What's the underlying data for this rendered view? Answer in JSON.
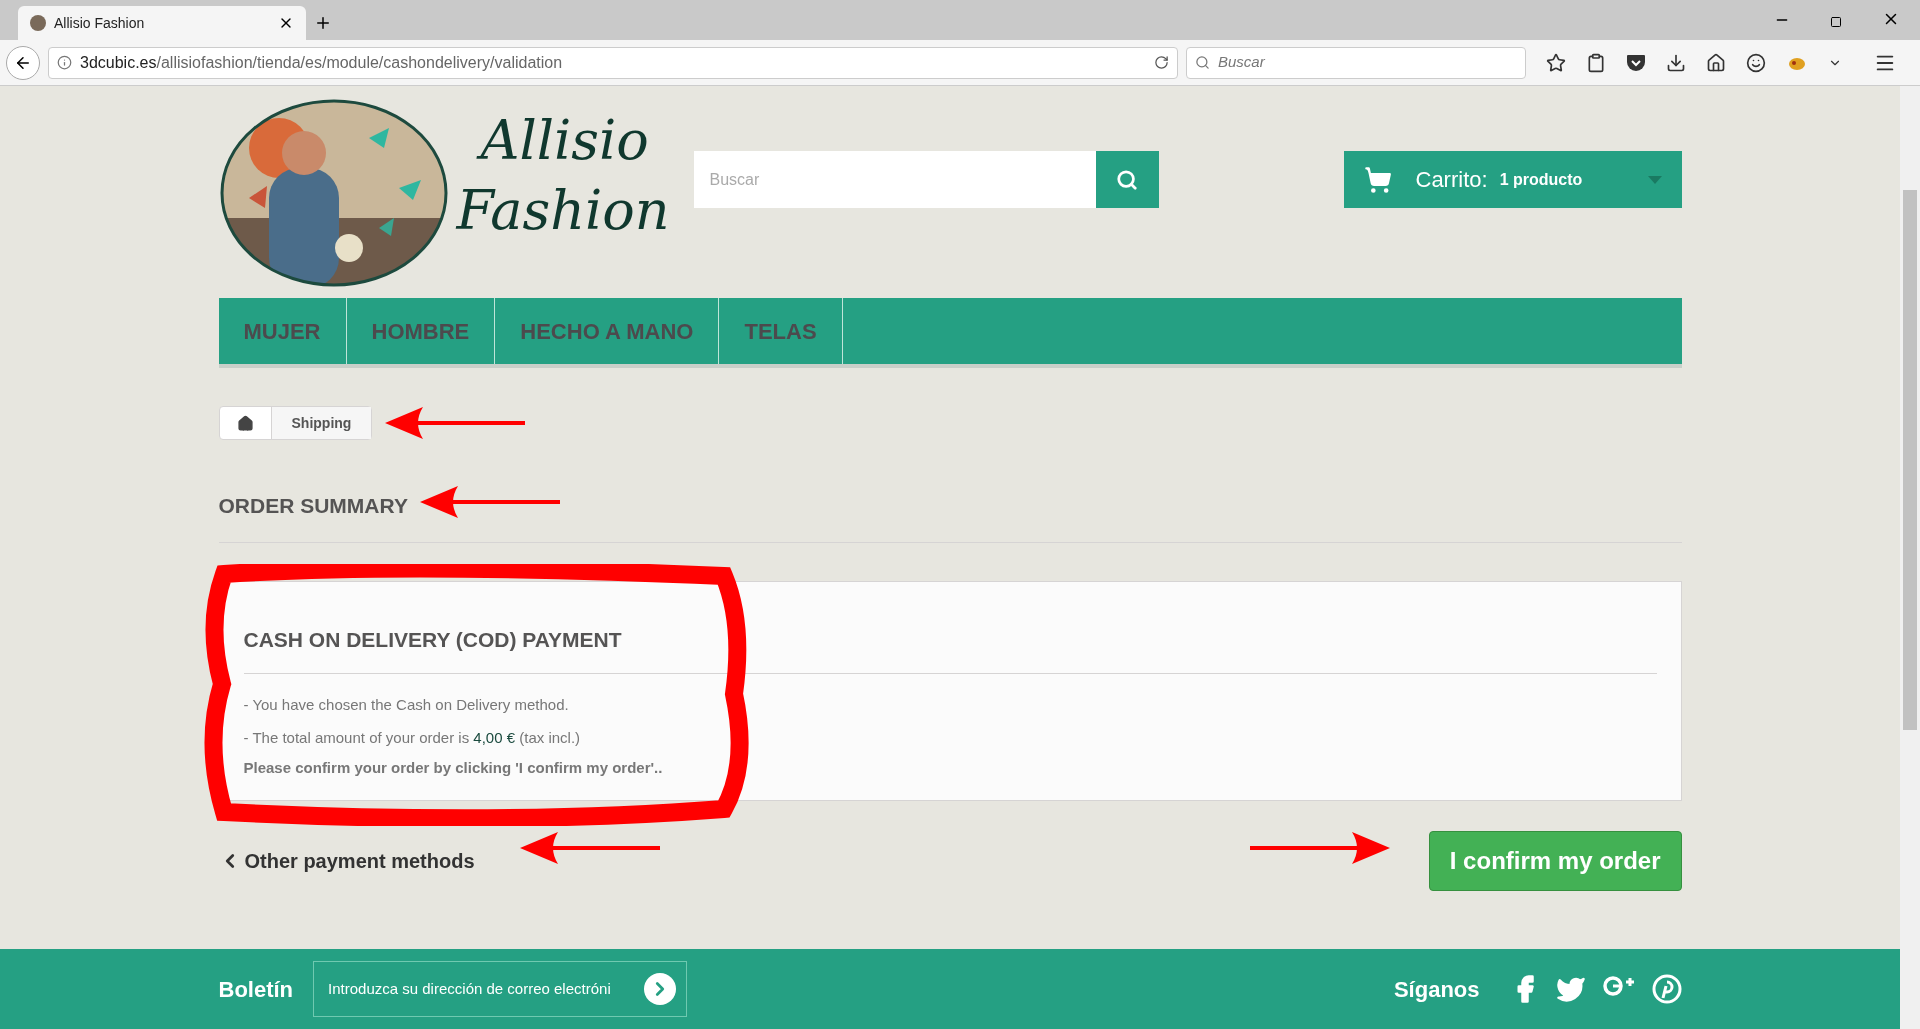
{
  "browser": {
    "tab_title": "Allisio Fashion",
    "url_domain": "3dcubic.es",
    "url_path": "/allisiofashion/tienda/es/module/cashondelivery/validation",
    "search_placeholder": "Buscar"
  },
  "header": {
    "logo_line1": "Allisio",
    "logo_line2": "Fashion",
    "search_placeholder": "Buscar",
    "cart_label": "Carrito:",
    "cart_count": "1 producto"
  },
  "nav": [
    "MUJER",
    "HOMBRE",
    "HECHO A MANO",
    "TELAS"
  ],
  "breadcrumb": [
    "Shipping"
  ],
  "page_title": "ORDER SUMMARY",
  "payment": {
    "title": "CASH ON DELIVERY (COD) PAYMENT",
    "line1": "- You have chosen the Cash on Delivery method.",
    "line2_before": "- The total amount of your order is",
    "amount": "4,00 €",
    "line2_after": "(tax incl.)",
    "note": "Please confirm your order by clicking 'I confirm my order'.."
  },
  "actions": {
    "back": "Other payment methods",
    "confirm": "I confirm my order"
  },
  "footer": {
    "newsletter_label": "Boletín",
    "newsletter_placeholder": "Introduzca su dirección de correo electróni",
    "follow_label": "Síganos"
  }
}
